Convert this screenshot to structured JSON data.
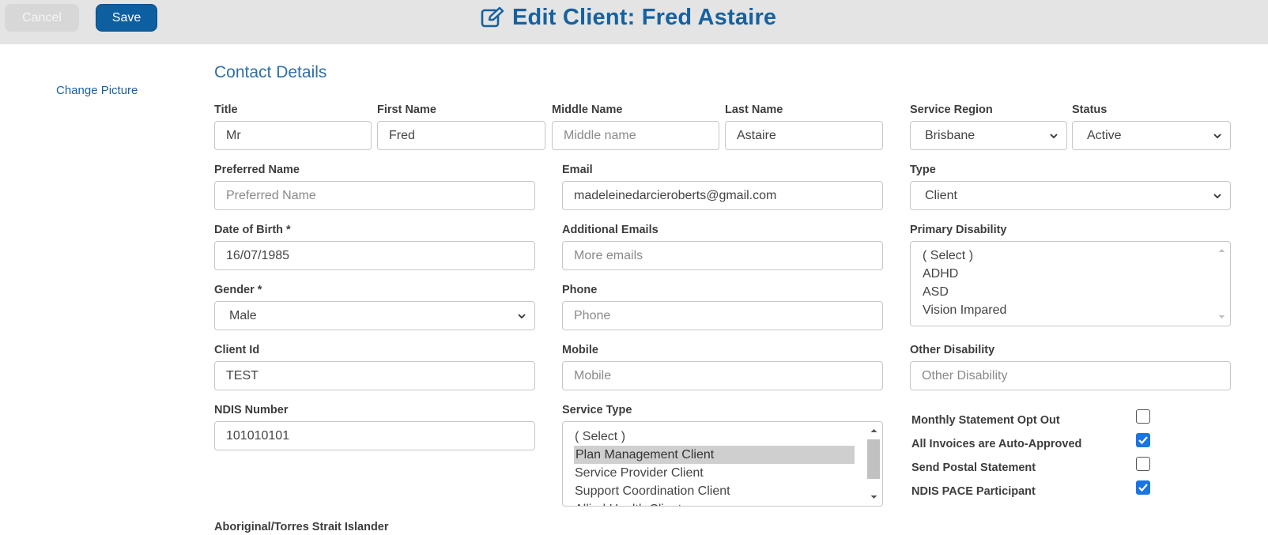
{
  "header": {
    "cancel_label": "Cancel",
    "save_label": "Save",
    "title": "Edit Client: Fred Astaire",
    "title_icon": "edit-icon"
  },
  "sidebar": {
    "change_picture_label": "Change Picture"
  },
  "section": {
    "title": "Contact Details"
  },
  "fields": {
    "title": {
      "label": "Title",
      "value": "Mr"
    },
    "first_name": {
      "label": "First Name",
      "value": "Fred"
    },
    "middle_name": {
      "label": "Middle Name",
      "placeholder": "Middle name"
    },
    "last_name": {
      "label": "Last Name",
      "value": "Astaire"
    },
    "service_region": {
      "label": "Service Region",
      "value": "Brisbane"
    },
    "status": {
      "label": "Status",
      "value": "Active"
    },
    "preferred_name": {
      "label": "Preferred Name",
      "placeholder": "Preferred Name"
    },
    "email": {
      "label": "Email",
      "value": "madeleinedarcieroberts@gmail.com"
    },
    "type": {
      "label": "Type",
      "value": "Client"
    },
    "dob": {
      "label": "Date of Birth *",
      "value": "16/07/1985"
    },
    "additional_emails": {
      "label": "Additional Emails",
      "placeholder": "More emails"
    },
    "primary_disability": {
      "label": "Primary Disability",
      "options": [
        "( Select )",
        "ADHD",
        "ASD",
        "Vision Impared"
      ]
    },
    "gender": {
      "label": "Gender *",
      "value": "Male"
    },
    "phone": {
      "label": "Phone",
      "placeholder": "Phone"
    },
    "client_id": {
      "label": "Client Id",
      "value": "TEST"
    },
    "mobile": {
      "label": "Mobile",
      "placeholder": "Mobile"
    },
    "other_disability": {
      "label": "Other Disability",
      "placeholder": "Other Disability"
    },
    "ndis_number": {
      "label": "NDIS Number",
      "value": "101010101"
    },
    "service_type": {
      "label": "Service Type",
      "options": [
        "( Select )",
        "Plan Management Client",
        "Service Provider Client",
        "Support Coordination Client",
        "Allied Health Client"
      ],
      "selected": "Plan Management Client"
    },
    "aboriginal": {
      "label": "Aboriginal/Torres Strait Islander"
    }
  },
  "checkboxes": [
    {
      "label": "Monthly Statement Opt Out",
      "checked": false
    },
    {
      "label": "All Invoices are Auto-Approved",
      "checked": true
    },
    {
      "label": "Send Postal Statement",
      "checked": false
    },
    {
      "label": "NDIS PACE Participant",
      "checked": true
    }
  ],
  "colors": {
    "brand": "#0e5fa0",
    "header_bg": "#e4e4e4",
    "checkbox_on": "#1a74e2"
  }
}
